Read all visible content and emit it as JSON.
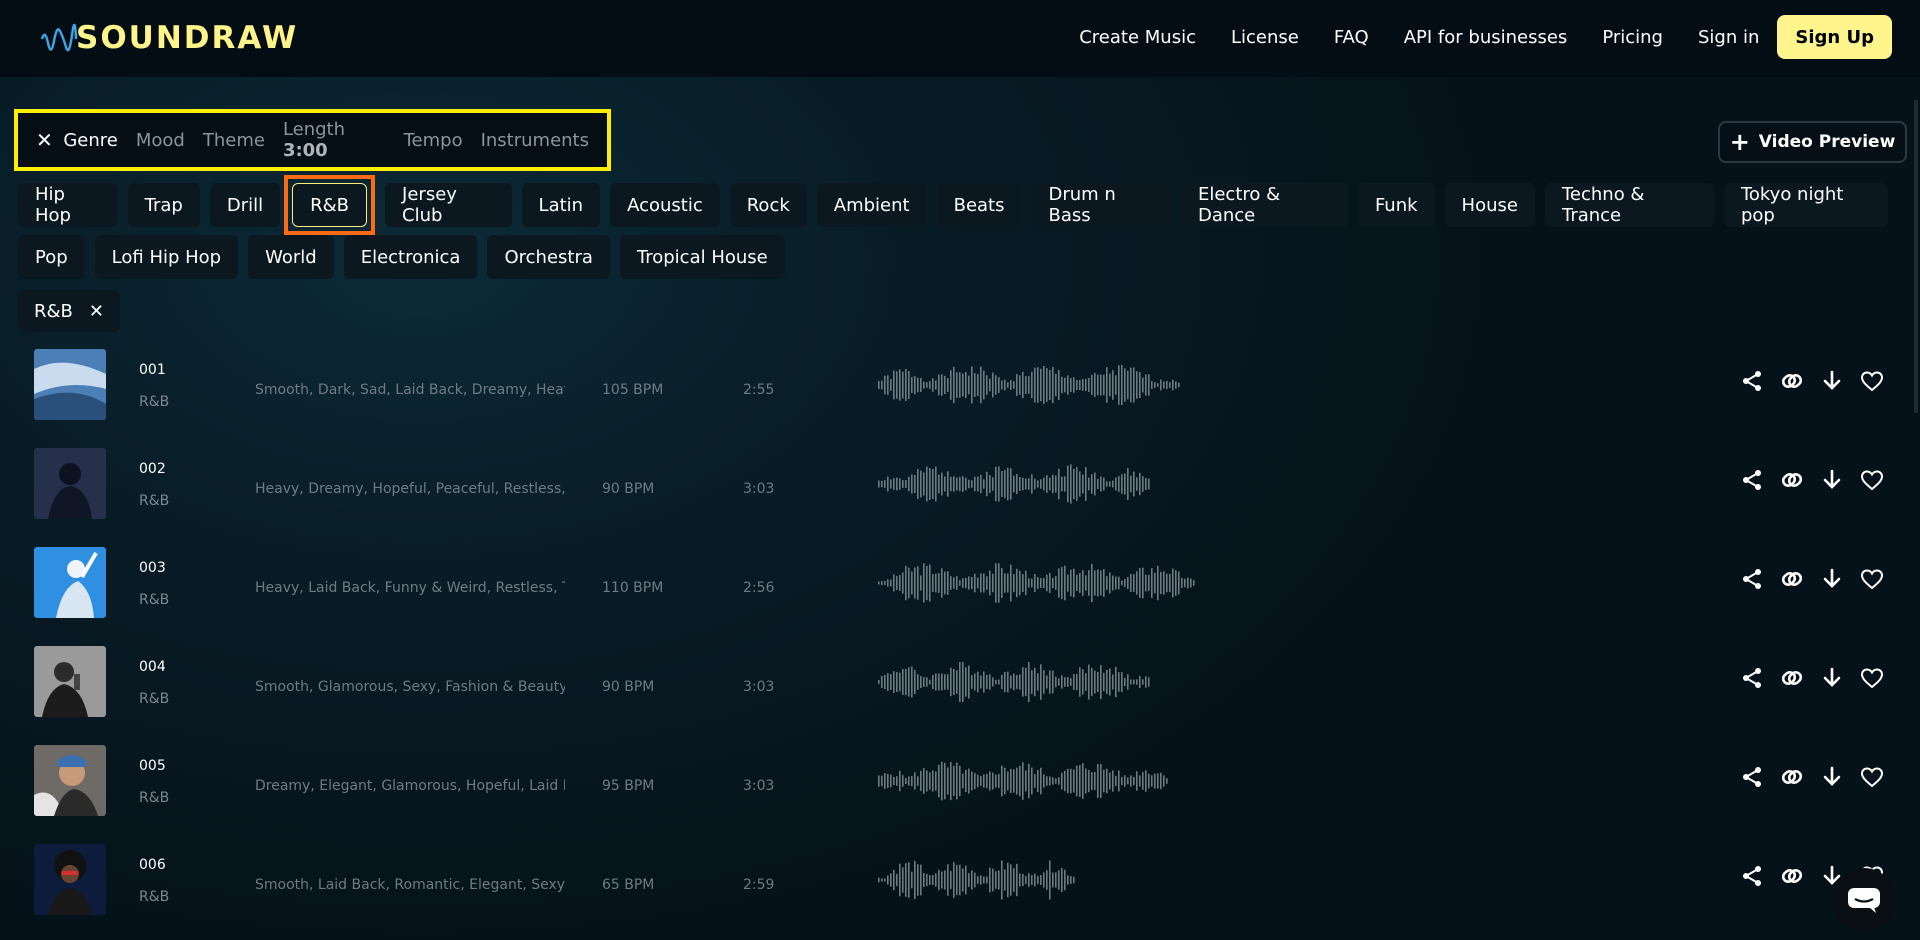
{
  "header": {
    "logo_text": "SOUNDRAW",
    "nav": [
      "Create Music",
      "License",
      "FAQ",
      "API for businesses",
      "Pricing",
      "Sign in"
    ],
    "signup_label": "Sign Up"
  },
  "filters": {
    "close_icon": "close-icon",
    "tabs": [
      {
        "label": "Genre",
        "active": true
      },
      {
        "label": "Mood"
      },
      {
        "label": "Theme"
      },
      {
        "label": "Length",
        "value": "3:00"
      },
      {
        "label": "Tempo"
      },
      {
        "label": "Instruments"
      }
    ],
    "video_preview_label": "Video Preview"
  },
  "genres": {
    "row1": [
      "Hip Hop",
      "Trap",
      "Drill",
      "R&B",
      "Jersey Club",
      "Latin",
      "Acoustic",
      "Rock",
      "Ambient",
      "Beats",
      "Drum n Bass",
      "Electro & Dance",
      "Funk",
      "House",
      "Techno & Trance",
      "Tokyo night pop"
    ],
    "row2": [
      "Pop",
      "Lofi Hip Hop",
      "World",
      "Electronica",
      "Orchestra",
      "Tropical House"
    ],
    "selected": "R&B"
  },
  "active_filter": {
    "label": "R&B"
  },
  "tracks": [
    {
      "num": "001",
      "genre": "R&B",
      "tags": "Smooth, Dark, Sad, Laid Back, Dreamy, Heav...",
      "bpm": "105 BPM",
      "duration": "2:55",
      "wave_len": 0.72
    },
    {
      "num": "002",
      "genre": "R&B",
      "tags": "Heavy, Dreamy, Hopeful, Peaceful, Restless, ...",
      "bpm": "90 BPM",
      "duration": "3:03",
      "wave_len": 0.65
    },
    {
      "num": "003",
      "genre": "R&B",
      "tags": "Heavy, Laid Back, Funny & Weird, Restless, T...",
      "bpm": "110 BPM",
      "duration": "2:56",
      "wave_len": 0.76
    },
    {
      "num": "004",
      "genre": "R&B",
      "tags": "Smooth, Glamorous, Sexy, Fashion & Beauty, ...",
      "bpm": "90 BPM",
      "duration": "3:03",
      "wave_len": 0.65
    },
    {
      "num": "005",
      "genre": "R&B",
      "tags": "Dreamy, Elegant, Glamorous, Hopeful, Laid B...",
      "bpm": "95 BPM",
      "duration": "3:03",
      "wave_len": 0.69
    },
    {
      "num": "006",
      "genre": "R&B",
      "tags": "Smooth, Laid Back, Romantic, Elegant, Sexy, ...",
      "bpm": "65 BPM",
      "duration": "2:59",
      "wave_len": 0.47
    }
  ],
  "colors": {
    "accent": "#fff58c",
    "highlight_yellow": "#ffee00",
    "highlight_orange": "#ff6a13",
    "bg": "#061219"
  },
  "icons": {
    "share": "share-icon",
    "link": "link-icon",
    "download": "download-arrow-icon",
    "like": "heart-icon",
    "chat": "chat-icon"
  }
}
